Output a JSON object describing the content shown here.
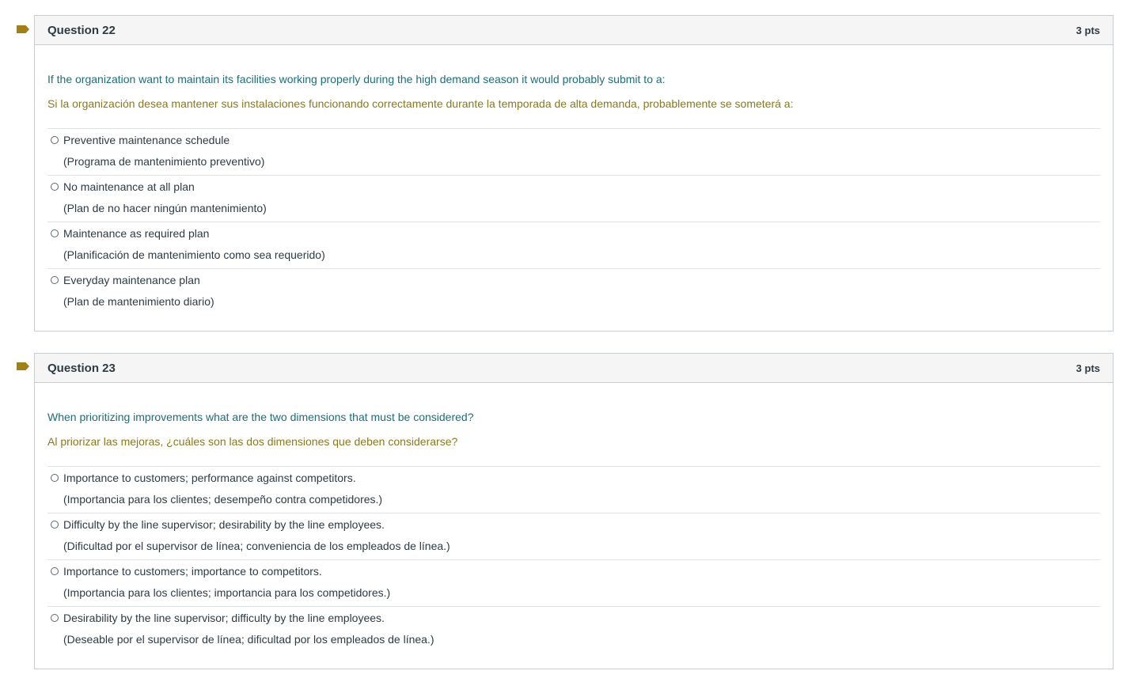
{
  "colors": {
    "flag": "#a37f14",
    "english_text": "#1c6e7a",
    "spanish_text": "#8a7a18",
    "border": "#c7cdd1"
  },
  "questions": [
    {
      "title": "Question 22",
      "points": "3 pts",
      "text_en": "If the organization want to maintain its facilities working properly during the high demand season it would probably submit to a:",
      "text_es": "Si la organización desea mantener sus instalaciones funcionando correctamente durante la temporada de alta demanda, probablemente se someterá a:",
      "answers": [
        {
          "en": "Preventive maintenance schedule",
          "es": "(Programa de mantenimiento preventivo)"
        },
        {
          "en": "No maintenance at all plan",
          "es": "(Plan de no hacer ningún mantenimiento)"
        },
        {
          "en": "Maintenance as required plan",
          "es": "(Planificación de mantenimiento como sea requerido)"
        },
        {
          "en": "Everyday maintenance plan",
          "es": "(Plan de mantenimiento diario)"
        }
      ]
    },
    {
      "title": "Question 23",
      "points": "3 pts",
      "text_en": "When prioritizing improvements what are the two dimensions that must be considered?",
      "text_es": "Al priorizar las mejoras, ¿cuáles son las dos dimensiones que deben considerarse?",
      "answers": [
        {
          "en": "Importance to customers; performance against competitors.",
          "es": "(Importancia para los clientes; desempeño contra competidores.)"
        },
        {
          "en": "Difficulty by the line supervisor; desirability by the line employees.",
          "es": "(Dificultad por el supervisor de línea; conveniencia de los empleados de línea.)"
        },
        {
          "en": "Importance to customers; importance to competitors.",
          "es": "(Importancia para los clientes; importancia para los competidores.)"
        },
        {
          "en": "Desirability by the line supervisor; difficulty by the line employees.",
          "es": "(Deseable por el supervisor de línea; dificultad por los empleados de línea.)"
        }
      ]
    }
  ]
}
